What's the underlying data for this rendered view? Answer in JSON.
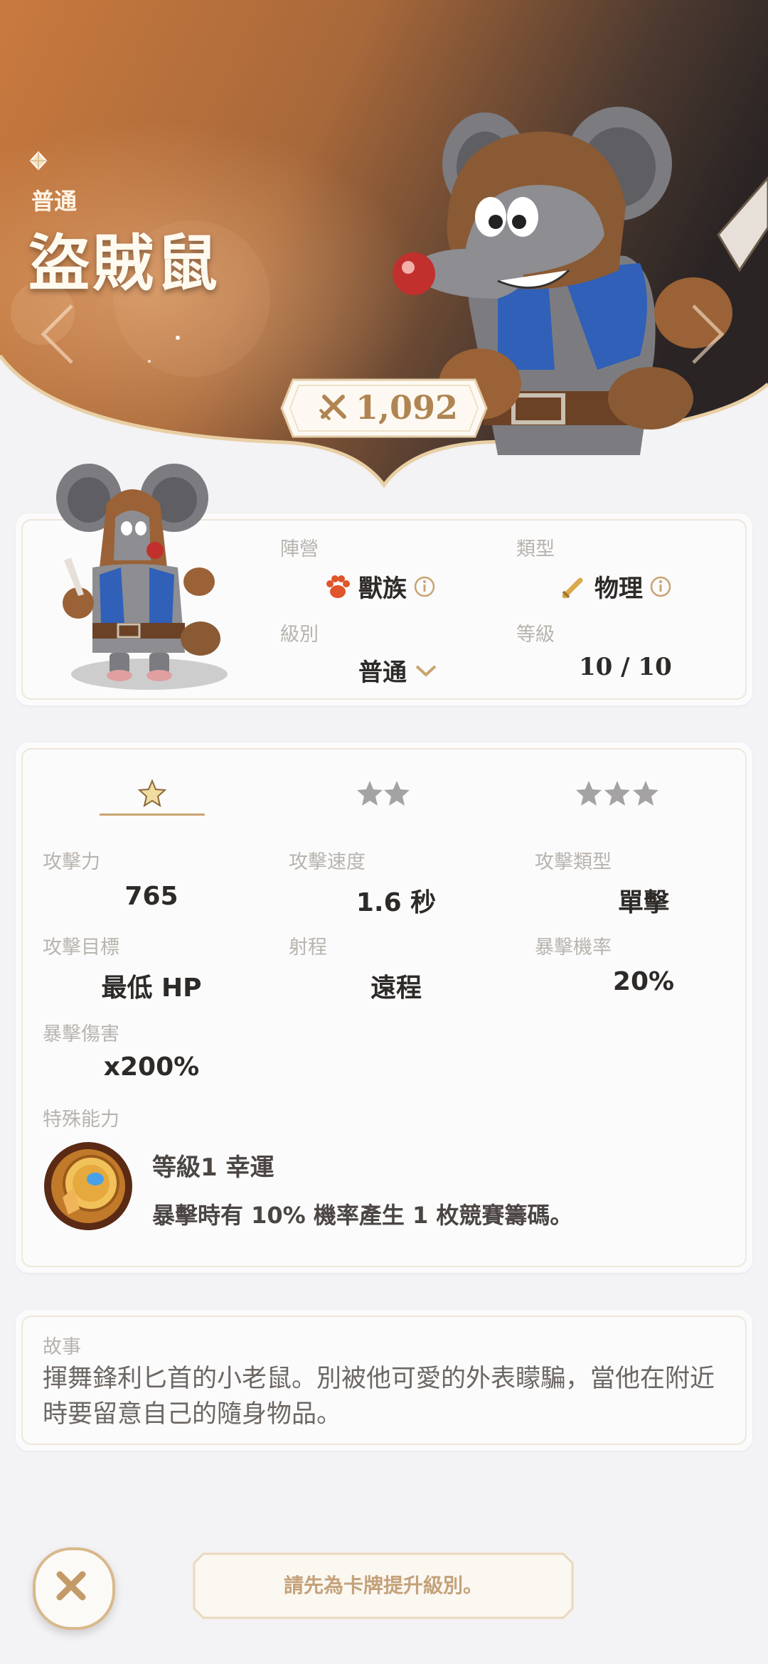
{
  "hero": {
    "rarity": "普通",
    "name": "盜賊鼠",
    "power": "1,092"
  },
  "info": {
    "faction_label": "陣營",
    "faction_value": "獸族",
    "type_label": "類型",
    "type_value": "物理",
    "tier_label": "級別",
    "tier_value": "普通",
    "level_label": "等級",
    "level_value": "10 / 10"
  },
  "stats": {
    "tabs": [
      "1 star",
      "2 stars",
      "3 stars"
    ],
    "attack_label": "攻擊力",
    "attack_value": "765",
    "attack_speed_label": "攻擊速度",
    "attack_speed_value": "1.6 秒",
    "attack_type_label": "攻擊類型",
    "attack_type_value": "單擊",
    "target_label": "攻擊目標",
    "target_value": "最低 HP",
    "range_label": "射程",
    "range_value": "遠程",
    "crit_rate_label": "暴擊機率",
    "crit_rate_value": "20%",
    "crit_damage_label": "暴擊傷害",
    "crit_damage_value": "x200%",
    "special_label": "特殊能力",
    "skill_title": "等級1 幸運",
    "skill_desc": "暴擊時有 10% 機率產生 1 枚競賽籌碼。"
  },
  "story": {
    "label": "故事",
    "text": "揮舞鋒利匕首的小老鼠。別被他可愛的外表矇騙，當他在附近時要留意自己的隨身物品。"
  },
  "footer": {
    "hint": "請先為卡牌提升級別。"
  },
  "colors": {
    "accent": "#c9a470",
    "hero_gradient_start": "#c97a3e",
    "hero_gradient_end": "#2a2424"
  },
  "icons": [
    "gem-icon",
    "sword-power-icon",
    "paw-icon",
    "info-icon",
    "sword-icon",
    "chevron-down-icon",
    "star-icon",
    "skill-coin-icon",
    "close-icon",
    "arrow-left-icon",
    "arrow-right-icon"
  ]
}
